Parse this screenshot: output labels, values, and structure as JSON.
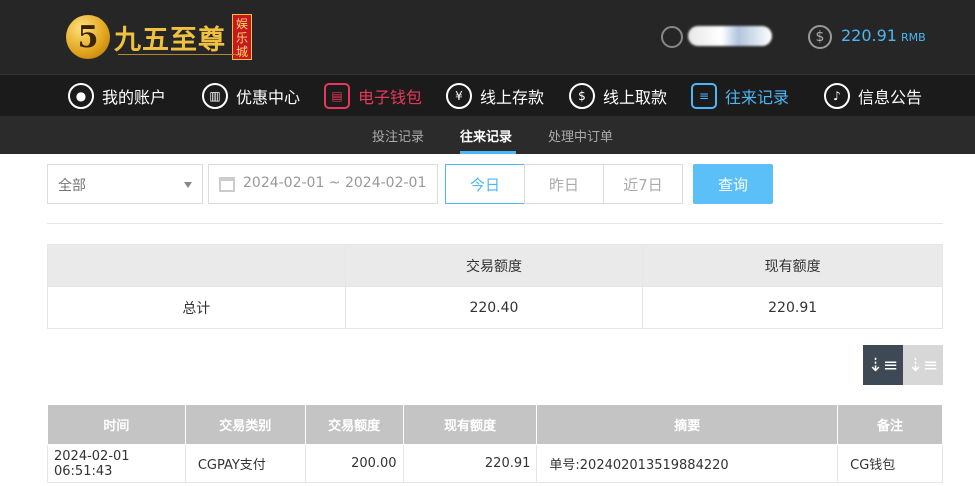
{
  "brand": {
    "badge": "5",
    "name": "九五至尊",
    "tag": "娱乐城"
  },
  "account": {
    "balance": "220.91",
    "currency": "RMB"
  },
  "nav": [
    {
      "label": "我的账户",
      "icon": "user-icon"
    },
    {
      "label": "优惠中心",
      "icon": "gift-icon"
    },
    {
      "label": "电子钱包",
      "icon": "wallet-icon"
    },
    {
      "label": "线上存款",
      "icon": "deposit-icon"
    },
    {
      "label": "线上取款",
      "icon": "withdraw-icon"
    },
    {
      "label": "往来记录",
      "icon": "records-icon"
    },
    {
      "label": "信息公告",
      "icon": "bell-icon"
    }
  ],
  "subtabs": [
    "投注记录",
    "往来记录",
    "处理中订单"
  ],
  "filter": {
    "type_selected": "全部",
    "date_range": "2024-02-01 ~ 2024-02-01",
    "today": "今日",
    "yesterday": "昨日",
    "last7": "近7日",
    "query": "查询"
  },
  "summary": {
    "headers": [
      "",
      "交易额度",
      "现有额度"
    ],
    "row": [
      "总计",
      "220.40",
      "220.91"
    ]
  },
  "detail": {
    "headers": [
      "时间",
      "交易类别",
      "交易额度",
      "现有额度",
      "摘要",
      "备注"
    ],
    "rows": [
      [
        "2024-02-01 06:51:43",
        "CGPAY支付",
        "200.00",
        "220.91",
        "单号:202402013519884220",
        "CG钱包"
      ]
    ]
  },
  "colors": {
    "accent": "#4db6f5",
    "active_red": "#e8385a",
    "brand_gold": "#f0c040"
  }
}
